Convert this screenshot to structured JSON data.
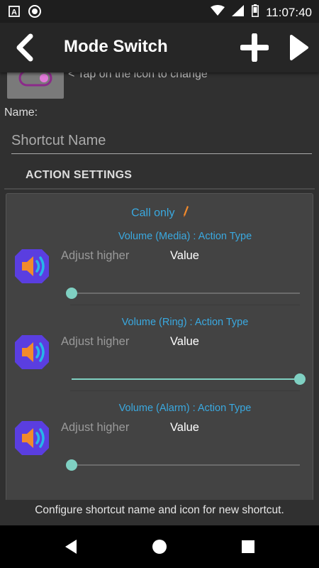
{
  "status_bar": {
    "time": "11:07:40",
    "icons": [
      "a-notification-icon",
      "record-icon",
      "wifi-icon",
      "signal-icon",
      "battery-icon"
    ]
  },
  "app_bar": {
    "title": "Mode Switch",
    "back_icon": "back-chevron-icon",
    "add_icon": "plus-icon",
    "run_icon": "play-icon"
  },
  "shortcut": {
    "tap_hint": "< Tap on the icon to change",
    "name_label": "Name:",
    "name_value": "",
    "name_placeholder": "Shortcut Name"
  },
  "action_settings": {
    "title": "ACTION SETTINGS",
    "mode_label": "Call only",
    "volumes": [
      {
        "type_label": "Volume (Media) : Action Type",
        "action": "Adjust higher",
        "value_label": "Value",
        "level": 0.0
      },
      {
        "type_label": "Volume (Ring) : Action Type",
        "action": "Adjust higher",
        "value_label": "Value",
        "level": 1.0
      },
      {
        "type_label": "Volume (Alarm) : Action Type",
        "action": "Adjust higher",
        "value_label": "Value",
        "level": 0.0
      }
    ]
  },
  "footer": {
    "text": "Configure shortcut name and icon for new shortcut."
  },
  "colors": {
    "accent_blue": "#3aa9e0",
    "slider_teal": "#7fd0c2",
    "icon_purple": "#5a3ee0",
    "icon_orange": "#f28a2c",
    "icon_cyan": "#27b6e8"
  }
}
